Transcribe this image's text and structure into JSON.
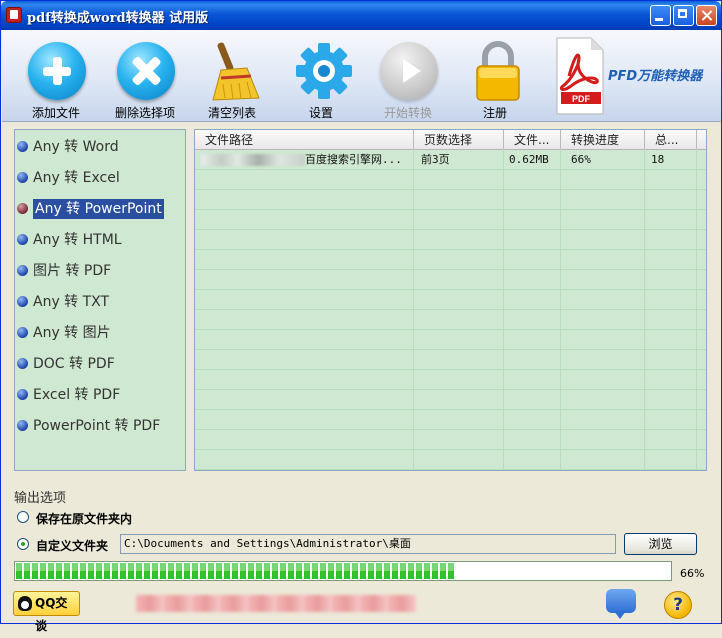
{
  "window": {
    "title": "pdf转换成word转换器 试用版"
  },
  "toolbar": {
    "buttons": [
      {
        "label": "添加文件",
        "icon": "add-file-icon"
      },
      {
        "label": "删除选择项",
        "icon": "delete-icon"
      },
      {
        "label": "清空列表",
        "icon": "broom-icon"
      },
      {
        "label": "设置",
        "icon": "gear-icon"
      },
      {
        "label": "开始转换",
        "icon": "play-icon",
        "disabled": true
      },
      {
        "label": "注册",
        "icon": "lock-icon"
      }
    ],
    "pdf_badge": "PDF",
    "brand": "PFD万能转换器"
  },
  "conversions": {
    "items": [
      {
        "label": "Any 转 Word"
      },
      {
        "label": "Any 转 Excel"
      },
      {
        "label": "Any 转 PowerPoint",
        "selected": true
      },
      {
        "label": "Any 转 HTML"
      },
      {
        "label": "图片 转 PDF"
      },
      {
        "label": "Any 转 TXT"
      },
      {
        "label": "Any 转 图片"
      },
      {
        "label": "DOC 转 PDF"
      },
      {
        "label": "Excel 转 PDF"
      },
      {
        "label": "PowerPoint 转 PDF"
      }
    ]
  },
  "file_list": {
    "columns": [
      "文件路径",
      "页数选择",
      "文件...",
      "转换进度",
      "总..."
    ],
    "rows": [
      {
        "path": "百度搜索引擎网...",
        "pages": "前3页",
        "size": "0.62MB",
        "progress": "66%",
        "total": "18"
      }
    ]
  },
  "output": {
    "title": "输出选项",
    "option_original": "保存在原文件夹内",
    "option_custom": "自定义文件夹",
    "custom_selected": true,
    "path": "C:\\Documents and Settings\\Administrator\\桌面",
    "browse_label": "浏览"
  },
  "progress": {
    "value": 0.67,
    "text": "66%"
  },
  "footer": {
    "qq_label": "QQ交谈",
    "help_label": "?"
  },
  "colors": {
    "title_bar": "#0b56d6",
    "panel_bg": "#cfe8d2",
    "progress": "#2ec22e",
    "brand": "#1f5fb5"
  }
}
